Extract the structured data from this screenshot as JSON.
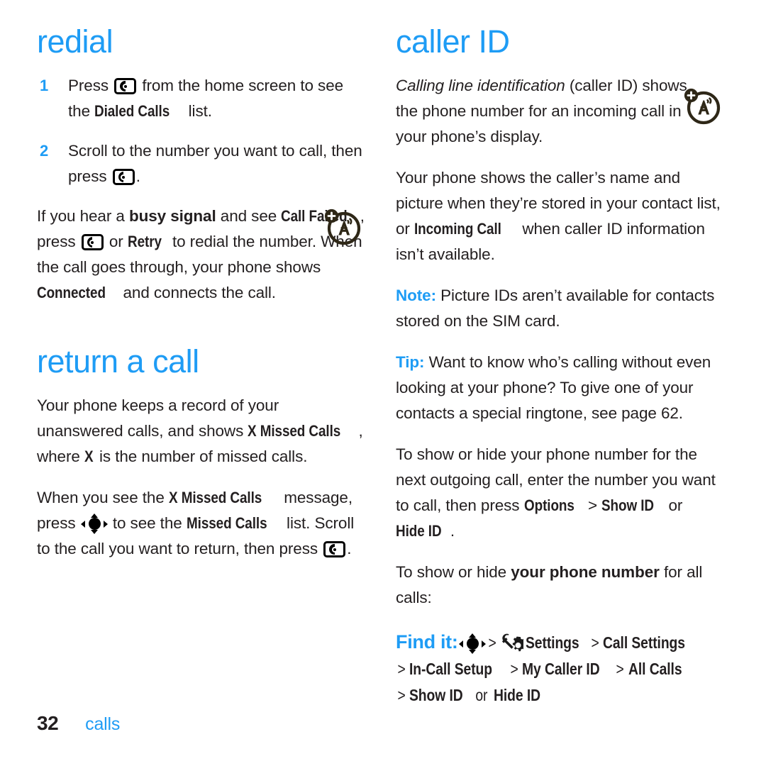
{
  "page": {
    "folio_number": "32",
    "chapter": "calls",
    "accent_color": "#1e9cf5",
    "text_color": "#231f20"
  },
  "left_column": {
    "section1": {
      "title": "redial",
      "steps": [
        {
          "num": "1",
          "part1": "Press",
          "icon": "send-key-icon",
          "part2": "from the home screen to see the",
          "ui_label": "Dialed Calls",
          "part3": "list."
        },
        {
          "num": "2",
          "part1": "Scroll to the number you want to call, then press",
          "icon": "send-key-icon",
          "part2": "."
        }
      ],
      "paragraph": {
        "t1": "If you hear a ",
        "b1": "busy signal",
        "t2": " and see ",
        "ui1": "Call Failed",
        "t3": ", press ",
        "icon": "send-key-icon",
        "t4": " or ",
        "ui2": "Retry",
        "t5": " to redial the number. When the call goes through, your phone shows ",
        "ui3": "Connected",
        "t6": " and connects the call."
      },
      "badge_icon": "network-feature-icon"
    },
    "section2": {
      "title": "return a call",
      "paragraph1": {
        "t1": "Your phone keeps a record of your unanswered calls, and shows ",
        "ui1": "X Missed Calls",
        "t2": ", where ",
        "b1": "X",
        "t3": " is the number of missed calls."
      },
      "paragraph2": {
        "t1": "When you see the ",
        "ui1": "X Missed Calls",
        "t2": " message, press ",
        "icon1": "nav-key-icon",
        "t3": " to see the ",
        "ui2": "Missed Calls",
        "t4": " list. Scroll to the call you want to return, then press ",
        "icon2": "send-key-icon",
        "t5": "."
      }
    }
  },
  "right_column": {
    "title": "caller ID",
    "badge_icon": "network-feature-icon",
    "paragraph1": {
      "i1": "Calling line identification",
      "t1": " (caller ID) shows the phone number for an incoming call in your phone’s display."
    },
    "paragraph2": {
      "t1": "Your phone shows the caller’s name and picture when they’re stored in your contact list, or ",
      "ui1": "Incoming Call",
      "t2": " when caller ID information isn’t available."
    },
    "paragraph3": {
      "kw": "Note:",
      "t1": " Picture IDs aren’t available for contacts stored on the SIM card."
    },
    "paragraph4": {
      "kw": "Tip:",
      "t1": " Want to know who’s calling without even looking at your phone? To give one of your contacts a special ringtone, see page 62."
    },
    "paragraph5": {
      "t1": "To show or hide your phone number for the next outgoing call, enter the number you want to call, then press ",
      "ui1": "Options",
      "gt1": " > ",
      "ui2": "Show ID",
      "t2": " or ",
      "ui3": "Hide ID",
      "t3": "."
    },
    "paragraph6": {
      "t1": "To show or hide ",
      "b1": "your phone number",
      "t2": " for all calls:"
    },
    "find_it": {
      "label": "Find it:",
      "nav_icon": "nav-key-icon",
      "sep1": ">",
      "settings_icon": "settings-gear-wrench-icon",
      "item1": "Settings",
      "sep2": ">",
      "item2": "Call Settings",
      "sep3": ">",
      "item3": "In-Call Setup",
      "sep4": ">",
      "item4": "My Caller ID",
      "sep5": ">",
      "item5": "All Calls",
      "sep6": ">",
      "item6": "Show ID",
      "or": "or",
      "item7": "Hide ID"
    }
  }
}
